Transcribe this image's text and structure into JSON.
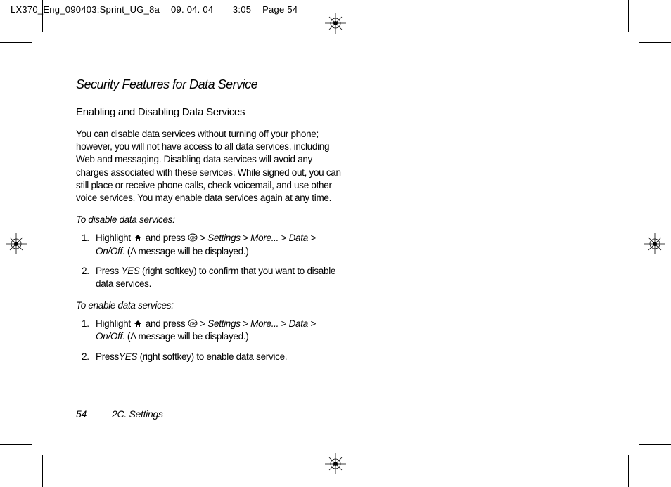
{
  "header": {
    "filename": "LX370_Eng_090403:Sprint_UG_8a",
    "date": "09. 04. 04",
    "time": "3:05",
    "page_label": "Page 54"
  },
  "section": {
    "title": "Security Features for Data Service",
    "subsection_title": "Enabling and Disabling Data Services",
    "intro": "You can disable data services without turning off your phone; however, you will not have access to all data services, including Web and messaging. Disabling data services will avoid any charges associated with these services. While signed out, you can still place or receive phone calls, check voicemail, and use other voice services. You may enable data services again at any time."
  },
  "disable": {
    "label": "To disable data services:",
    "step1_prefix": "Highlight ",
    "step1_mid": " and press ",
    "sep": " > ",
    "path1": "Settings",
    "path2": "More...",
    "path3": "Data",
    "path4": "On/Off",
    "step1_suffix": ". (A message will be displayed.)",
    "step2_prefix": "Press ",
    "yes": "YES",
    "step2_suffix": " (right softkey) to confirm that you want to disable data services."
  },
  "enable": {
    "label": "To enable data services:",
    "step1_prefix": "Highlight ",
    "step1_mid": " and press ",
    "sep": " > ",
    "path1": "Settings",
    "path2": "More...",
    "path3": "Data",
    "path4": "On/Off",
    "step1_suffix": ". (A message will be displayed.)",
    "step2_prefix": "Press",
    "yes": "YES",
    "step2_suffix": " (right softkey) to enable data service."
  },
  "footer": {
    "page_number": "54",
    "chapter": "2C. Settings"
  }
}
